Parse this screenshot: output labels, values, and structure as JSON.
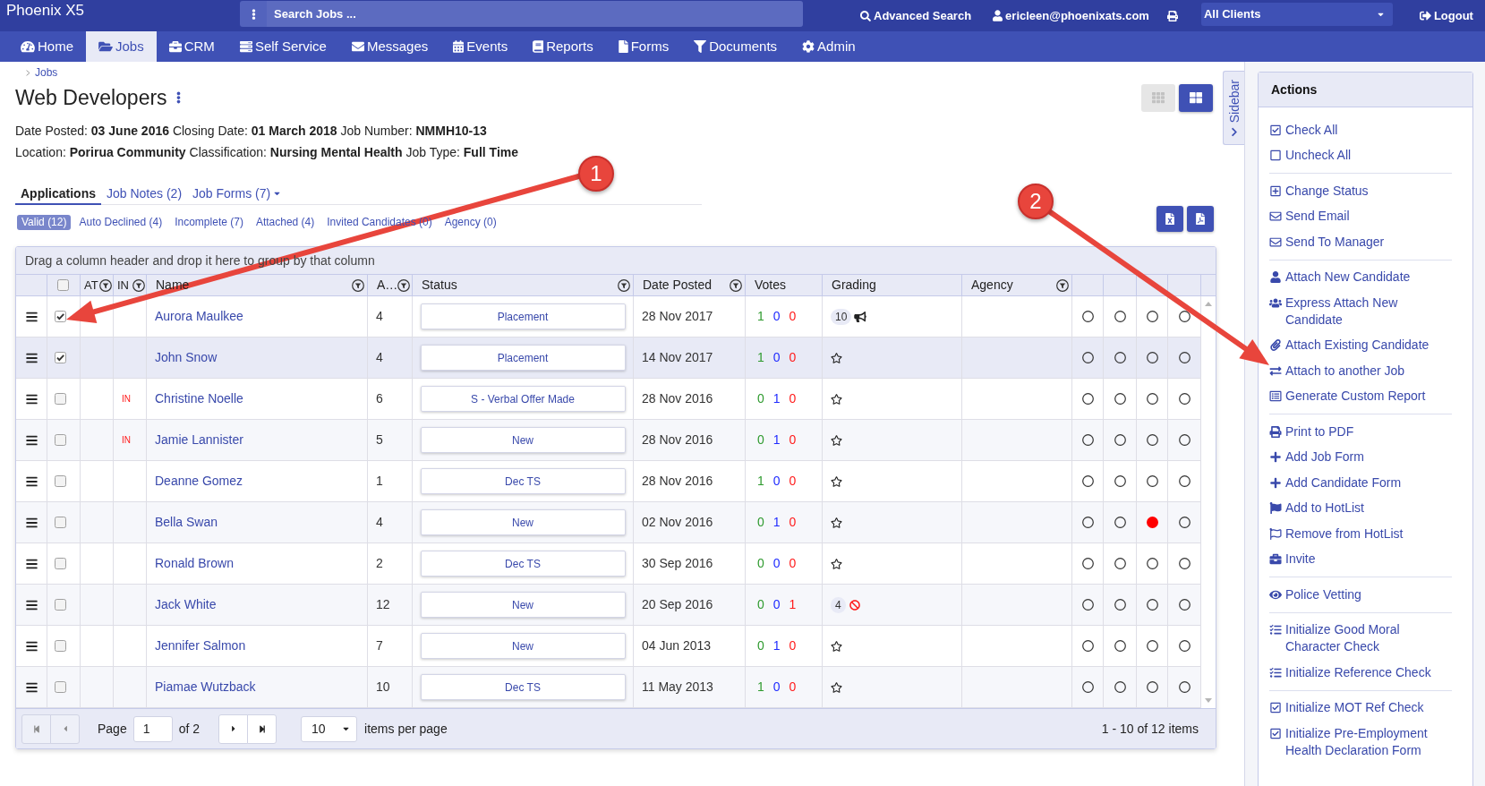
{
  "app_title": "Phoenix X5",
  "top_bar": {
    "search": {
      "placeholder": "Search Jobs ..."
    },
    "advanced_search": "Advanced Search",
    "user": "ericleen@phoenixats.com",
    "client_select": {
      "value": "All Clients"
    },
    "logout": "Logout"
  },
  "nav": [
    {
      "label": "Home",
      "selected": false
    },
    {
      "label": "Jobs",
      "selected": true
    },
    {
      "label": "CRM",
      "selected": false
    },
    {
      "label": "Self Service",
      "selected": false
    },
    {
      "label": "Messages",
      "selected": false
    },
    {
      "label": "Events",
      "selected": false
    },
    {
      "label": "Reports",
      "selected": false
    },
    {
      "label": "Forms",
      "selected": false
    },
    {
      "label": "Documents",
      "selected": false
    },
    {
      "label": "Admin",
      "selected": false
    }
  ],
  "breadcrumb": [
    "Jobs"
  ],
  "job": {
    "title": "Web Developers",
    "details": [
      "Date Posted: **03 June 2016** Closing Date: **01 March 2018** Job Number: **NMMH10-13**",
      "Location: **Porirua Community** Classification: **Nursing Mental Health** Job Type: **Full Time**"
    ]
  },
  "view_modes": [
    {
      "selected": false
    },
    {
      "selected": true
    }
  ],
  "tabs": [
    {
      "label": "Applications",
      "selected": true,
      "has_menu": false
    },
    {
      "label": "Job Notes (2)",
      "selected": false,
      "has_menu": false
    },
    {
      "label": "Job Forms (7)",
      "selected": false,
      "has_menu": true
    }
  ],
  "filters": [
    {
      "label": "Valid (12)",
      "selected": true
    },
    {
      "label": "Auto Declined (4)",
      "selected": false
    },
    {
      "label": "Incomplete (7)",
      "selected": false
    },
    {
      "label": "Attached (4)",
      "selected": false
    },
    {
      "label": "Invited Candidates (0)",
      "selected": false
    },
    {
      "label": "Agency (0)",
      "selected": false
    }
  ],
  "grid": {
    "group_hint": "Drag a column header and drop it here to group by that column",
    "select_all": false,
    "columns": [
      {
        "label": "AT",
        "filter": true
      },
      {
        "label": "IN",
        "filter": true
      },
      {
        "label": "Name",
        "filter": true
      },
      {
        "label": "A…",
        "filter": true
      },
      {
        "label": "Status",
        "filter": true
      },
      {
        "label": "Date Posted",
        "filter": true
      },
      {
        "label": "Votes",
        "filter": false
      },
      {
        "label": "Grading",
        "filter": false
      },
      {
        "label": "Agency",
        "filter": true
      }
    ],
    "rows": [
      {
        "checked": true,
        "selected": false,
        "name": "Aurora Maulkee",
        "a": "4",
        "status": "Placement",
        "date_posted": "28 Nov 2017",
        "votes": [
          "1",
          "0",
          "0"
        ],
        "grading": {
          "kind": "promoted",
          "count": "10"
        },
        "markers": [
          {
            "filled": false
          },
          {
            "filled": false
          },
          {
            "filled": false
          },
          {
            "filled": false
          }
        ]
      },
      {
        "checked": true,
        "selected": true,
        "name": "John Snow",
        "a": "4",
        "status": "Placement",
        "date_posted": "14 Nov 2017",
        "votes": [
          "1",
          "0",
          "0"
        ],
        "grading": {
          "kind": "ungraded"
        },
        "markers": [
          {
            "filled": false
          },
          {
            "filled": false
          },
          {
            "filled": false
          },
          {
            "filled": false
          }
        ]
      },
      {
        "checked": false,
        "selected": false,
        "in_label": "IN",
        "name": "Christine Noelle",
        "a": "6",
        "status": "S - Verbal Offer Made",
        "date_posted": "28 Nov 2016",
        "votes": [
          "0",
          "1",
          "0"
        ],
        "grading": {
          "kind": "ungraded"
        },
        "markers": [
          {
            "filled": false
          },
          {
            "filled": false
          },
          {
            "filled": false
          },
          {
            "filled": false
          }
        ]
      },
      {
        "checked": false,
        "selected": false,
        "in_label": "IN",
        "name": "Jamie Lannister",
        "a": "5",
        "status": "New",
        "date_posted": "28 Nov 2016",
        "votes": [
          "0",
          "1",
          "0"
        ],
        "grading": {
          "kind": "ungraded"
        },
        "markers": [
          {
            "filled": false
          },
          {
            "filled": false
          },
          {
            "filled": false
          },
          {
            "filled": false
          }
        ]
      },
      {
        "checked": false,
        "selected": false,
        "name": "Deanne Gomez",
        "a": "1",
        "status": "Dec TS",
        "date_posted": "28 Nov 2016",
        "votes": [
          "1",
          "0",
          "0"
        ],
        "grading": {
          "kind": "ungraded"
        },
        "markers": [
          {
            "filled": false
          },
          {
            "filled": false
          },
          {
            "filled": false
          },
          {
            "filled": false
          }
        ]
      },
      {
        "checked": false,
        "selected": false,
        "name": "Bella Swan",
        "a": "4",
        "status": "New",
        "date_posted": "02 Nov 2016",
        "votes": [
          "0",
          "1",
          "0"
        ],
        "grading": {
          "kind": "ungraded"
        },
        "markers": [
          {
            "filled": false
          },
          {
            "filled": false
          },
          {
            "filled": true
          },
          {
            "filled": false
          }
        ]
      },
      {
        "checked": false,
        "selected": false,
        "name": "Ronald Brown",
        "a": "2",
        "status": "Dec TS",
        "date_posted": "30 Sep 2016",
        "votes": [
          "0",
          "0",
          "0"
        ],
        "grading": {
          "kind": "ungraded"
        },
        "markers": [
          {
            "filled": false
          },
          {
            "filled": false
          },
          {
            "filled": false
          },
          {
            "filled": false
          }
        ]
      },
      {
        "checked": false,
        "selected": false,
        "name": "Jack White",
        "a": "12",
        "status": "New",
        "date_posted": "20 Sep 2016",
        "votes": [
          "0",
          "0",
          "1"
        ],
        "grading": {
          "kind": "blocked",
          "count": "4"
        },
        "markers": [
          {
            "filled": false
          },
          {
            "filled": false
          },
          {
            "filled": false
          },
          {
            "filled": false
          }
        ]
      },
      {
        "checked": false,
        "selected": false,
        "name": "Jennifer Salmon",
        "a": "7",
        "status": "New",
        "date_posted": "04 Jun 2013",
        "votes": [
          "0",
          "1",
          "0"
        ],
        "grading": {
          "kind": "ungraded"
        },
        "markers": [
          {
            "filled": false
          },
          {
            "filled": false
          },
          {
            "filled": false
          },
          {
            "filled": false
          }
        ]
      },
      {
        "checked": false,
        "selected": false,
        "name": "Piamae Wutzback",
        "a": "10",
        "status": "Dec TS",
        "date_posted": "11 May 2013",
        "votes": [
          "1",
          "0",
          "0"
        ],
        "grading": {
          "kind": "ungraded"
        },
        "markers": [
          {
            "filled": false
          },
          {
            "filled": false
          },
          {
            "filled": false
          },
          {
            "filled": false
          }
        ]
      }
    ],
    "pager": {
      "nav_buttons": [
        {
          "disabled": true
        },
        {
          "disabled": true
        },
        {
          "disabled": false
        },
        {
          "disabled": false
        }
      ],
      "page_label": "Page",
      "page": "1",
      "of_label": "of 2",
      "page_size": "10",
      "per_page_label": "items per page",
      "summary": "1 - 10 of 12 items"
    }
  },
  "sidebar_tab": "Sidebar",
  "actions": {
    "title": "Actions",
    "groups": [
      [
        "Check All",
        "Uncheck All"
      ],
      [
        "Change Status",
        "Send Email",
        "Send To Manager"
      ],
      [
        "Attach New Candidate",
        "Express Attach New Candidate",
        "Attach Existing Candidate",
        "Attach to another Job",
        "Generate Custom Report"
      ],
      [
        "Print to PDF",
        "Add Job Form",
        "Add Candidate Form",
        "Add to HotList",
        "Remove from HotList",
        "Invite"
      ],
      [
        "Police Vetting"
      ],
      [
        "Initialize Good Moral Character Check",
        "Initialize Reference Check"
      ],
      [
        "Initialize MOT Ref Check",
        "Initialize Pre-Employment Health Declaration Form"
      ]
    ]
  },
  "annotations": [
    {
      "label": "1"
    },
    {
      "label": "2"
    }
  ]
}
